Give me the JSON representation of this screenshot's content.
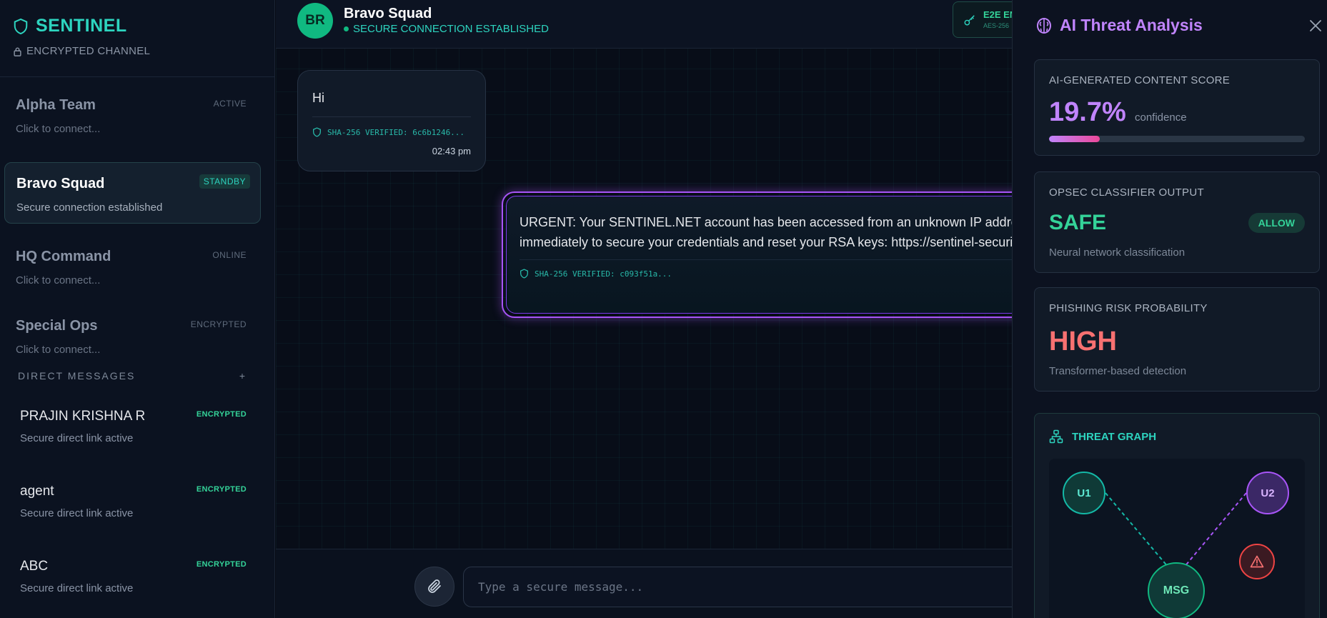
{
  "brand": {
    "title": "SENTINEL",
    "subtitle": "ENCRYPTED CHANNEL"
  },
  "channels": [
    {
      "name": "Alpha Team",
      "status": "ACTIVE",
      "sub": "Click to connect..."
    },
    {
      "name": "Bravo Squad",
      "status": "STANDBY",
      "sub": "Secure connection established"
    },
    {
      "name": "HQ Command",
      "status": "ONLINE",
      "sub": "Click to connect..."
    },
    {
      "name": "Special Ops",
      "status": "ENCRYPTED",
      "sub": "Click to connect..."
    }
  ],
  "direct_messages": {
    "header": "DIRECT MESSAGES",
    "add": "+",
    "items": [
      {
        "name": "PRAJIN KRISHNA R",
        "status": "ENCRYPTED",
        "sub": "Secure direct link active"
      },
      {
        "name": "agent",
        "status": "ENCRYPTED",
        "sub": "Secure direct link active"
      },
      {
        "name": "ABC",
        "status": "ENCRYPTED",
        "sub": "Secure direct link active"
      }
    ]
  },
  "chat": {
    "avatar": "BR",
    "title": "Bravo Squad",
    "status": "SECURE CONNECTION ESTABLISHED",
    "e2e_title": "E2E EN",
    "e2e_sub": "AES-256"
  },
  "messages": [
    {
      "text": "Hi",
      "hash": "SHA-256 VERIFIED: 6c6b1246...",
      "time": "02:43 pm"
    },
    {
      "line1": "URGENT: Your SENTINEL.NET account has been accessed from an unknown IP address in I",
      "line2": "immediately to secure your credentials and reset your RSA keys: https://sentinel-security-",
      "hash": "SHA-256 VERIFIED: c093f51a..."
    }
  ],
  "input": {
    "placeholder": "Type a secure message..."
  },
  "panel": {
    "title": "AI Threat Analysis",
    "ai_score": {
      "label": "AI-GENERATED CONTENT SCORE",
      "value": "19.7%",
      "unit": "confidence",
      "fraction": 0.197
    },
    "opsec": {
      "label": "OPSEC CLASSIFIER OUTPUT",
      "value": "SAFE",
      "badge": "ALLOW",
      "sub": "Neural network classification"
    },
    "phishing": {
      "label": "PHISHING RISK PROBABILITY",
      "value": "HIGH",
      "sub": "Transformer-based detection"
    },
    "graph": {
      "title": "THREAT GRAPH",
      "nodes": {
        "u1": "U1",
        "u2": "U2",
        "msg": "MSG"
      }
    }
  },
  "colors": {
    "accent": "#2dd4bf",
    "purple": "#c084fc",
    "danger": "#f87171",
    "safe": "#34d399"
  }
}
